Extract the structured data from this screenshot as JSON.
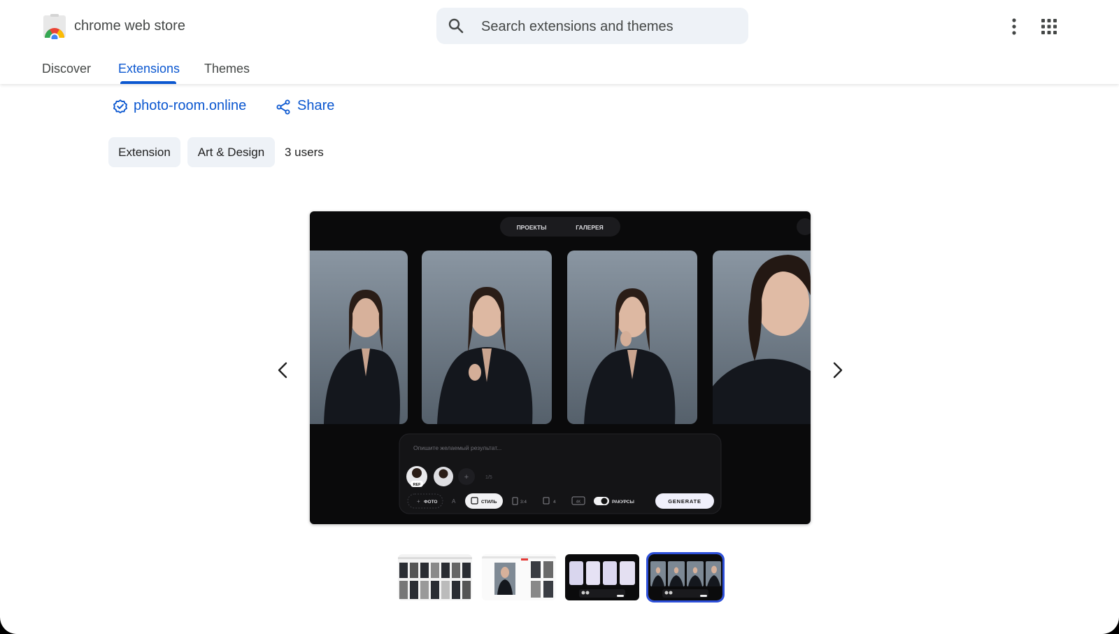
{
  "header": {
    "brand": "chrome web store",
    "search_placeholder": "Search extensions and themes",
    "nav": [
      {
        "label": "Discover",
        "active": false
      },
      {
        "label": "Extensions",
        "active": true
      },
      {
        "label": "Themes",
        "active": false
      }
    ]
  },
  "item": {
    "publisher": "photo-room.online",
    "share_label": "Share",
    "chips": [
      "Extension",
      "Art & Design"
    ],
    "users": "3 users"
  },
  "slide": {
    "tabs": [
      "ПРОЕКТЫ",
      "ГАЛЕРЕЯ"
    ],
    "prompt_placeholder": "Опишите желаемый результат...",
    "ref_label": "REF",
    "counter": "1/5",
    "tools": {
      "photo": "ФОТО",
      "style": "СТИЛЬ",
      "ratio": "3:4",
      "count": "4",
      "quality": "4K",
      "angles": "РАКУРСЫ"
    },
    "generate_label": "GENERATE"
  },
  "thumbnails": [
    {
      "selected": false
    },
    {
      "selected": false
    },
    {
      "selected": false
    },
    {
      "selected": true
    }
  ],
  "colors": {
    "accent": "#0b57d0",
    "chip_bg": "#eef2f7",
    "slide_bg": "#0a0a0b",
    "selected_thumb_border": "#2d4fd9"
  },
  "icons": {
    "logo": "chrome-web-store-logo",
    "search": "search-icon",
    "more": "more-vert-icon",
    "apps": "apps-grid-icon",
    "verified": "verified-badge-icon",
    "share": "share-icon",
    "prev": "chevron-left-icon",
    "next": "chevron-right-icon"
  }
}
